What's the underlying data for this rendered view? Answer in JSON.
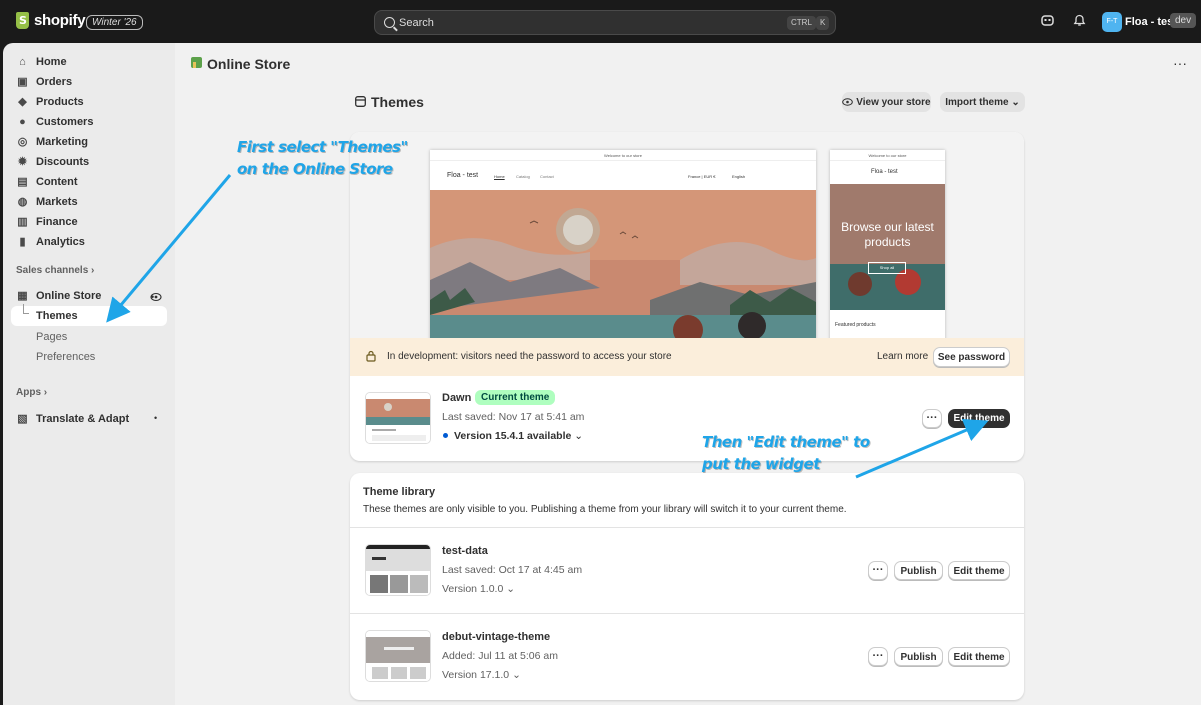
{
  "topbar": {
    "logo_text": "shopify",
    "edition_badge": "Winter '26",
    "search_placeholder": "Search",
    "shortcut_ctrl": "CTRL",
    "shortcut_k": "K",
    "avatar_initials": "F-T",
    "store_name": "Floa - test",
    "env_badge": "dev"
  },
  "sidebar": {
    "items": [
      {
        "label": "Home",
        "icon": "home-icon"
      },
      {
        "label": "Orders",
        "icon": "inbox-icon"
      },
      {
        "label": "Products",
        "icon": "tag-icon"
      },
      {
        "label": "Customers",
        "icon": "person-icon"
      },
      {
        "label": "Marketing",
        "icon": "target-icon"
      },
      {
        "label": "Discounts",
        "icon": "discount-icon"
      },
      {
        "label": "Content",
        "icon": "image-icon"
      },
      {
        "label": "Markets",
        "icon": "globe-icon"
      },
      {
        "label": "Finance",
        "icon": "bank-icon"
      },
      {
        "label": "Analytics",
        "icon": "chart-icon"
      }
    ],
    "sales_channels_label": "Sales channels",
    "online_store_label": "Online Store",
    "sub_items": [
      "Themes",
      "Pages",
      "Preferences"
    ],
    "apps_label": "Apps",
    "translate_label": "Translate & Adapt"
  },
  "main": {
    "page_title": "Online Store",
    "section_title": "Themes",
    "view_store_label": "View your store",
    "import_theme_label": "Import theme",
    "preview": {
      "announcement": "Welcome to our store",
      "store_brand": "Floa - test",
      "nav": [
        "Home",
        "Catalog",
        "Contact"
      ],
      "locale": "France | EUR €",
      "language": "English",
      "mobile_hero_text": "Browse our latest products",
      "mobile_button": "Shop all",
      "featured": "Featured products"
    },
    "banner_text": "In development: visitors need the password to access your store",
    "learn_more_label": "Learn more",
    "see_password_label": "See password",
    "current_theme": {
      "name": "Dawn",
      "badge": "Current theme",
      "last_saved": "Last saved: Nov 17 at 5:41 am",
      "version": "Version 15.4.1 available",
      "edit_label": "Edit theme"
    },
    "library": {
      "title": "Theme library",
      "description": "These themes are only visible to you. Publishing a theme from your library will switch it to your current theme.",
      "themes": [
        {
          "name": "test-data",
          "saved": "Last saved: Oct 17 at 4:45 am",
          "version": "Version 1.0.0",
          "publish_label": "Publish",
          "edit_label": "Edit theme"
        },
        {
          "name": "debut-vintage-theme",
          "saved": "Added: Jul 11 at 5:06 am",
          "version": "Version 17.1.0",
          "publish_label": "Publish",
          "edit_label": "Edit theme"
        }
      ]
    }
  },
  "annotations": {
    "first_line1": "First select \"Themes\"",
    "first_line2": "on the Online Store",
    "then_line1": "Then \"Edit theme\" to",
    "then_line2": "put the widget"
  },
  "colors": {
    "annotation": "#1fa5e8",
    "topbar": "#1a1a1a",
    "badge_green": "#affebf",
    "banner": "#fbeedb"
  }
}
